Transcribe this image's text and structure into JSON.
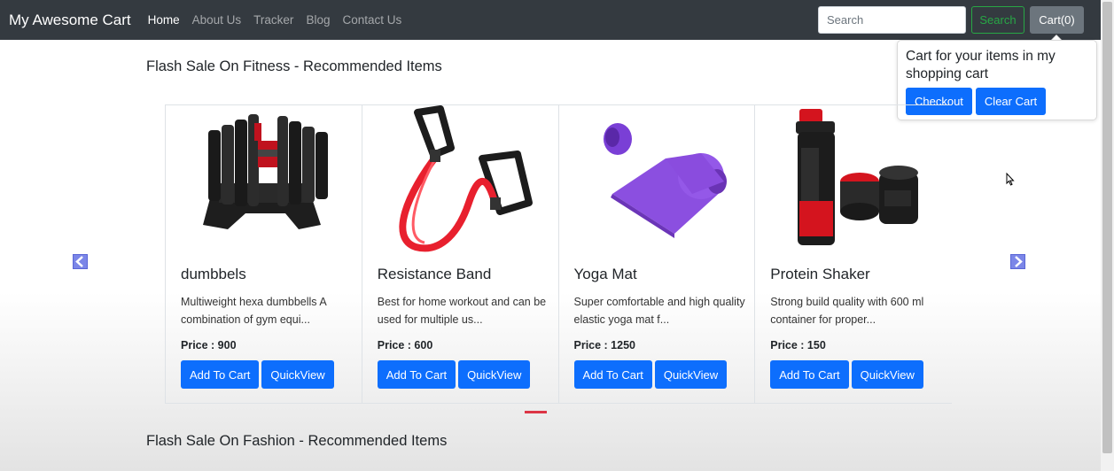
{
  "navbar": {
    "brand": "My Awesome Cart",
    "links": [
      "Home",
      "About Us",
      "Tracker",
      "Blog",
      "Contact Us"
    ],
    "search_placeholder": "Search",
    "search_button": "Search",
    "cart_button": "Cart(0)"
  },
  "cart_popover": {
    "text": "Cart for your items in my shopping cart",
    "checkout": "Checkout",
    "clear": "Clear Cart"
  },
  "sections": {
    "fitness_title": "Flash Sale On Fitness - Recommended Items",
    "fashion_title": "Flash Sale On Fashion - Recommended Items"
  },
  "products": [
    {
      "name": "dumbbels",
      "desc": "Multiweight hexa dumbbells A combination of gym equi...",
      "price": "Price : 900",
      "add": "Add To Cart",
      "quick": "QuickView",
      "icon": "dumbbell-image"
    },
    {
      "name": "Resistance Band",
      "desc": "Best for home workout and can be used for multiple us...",
      "price": "Price : 600",
      "add": "Add To Cart",
      "quick": "QuickView",
      "icon": "resistance-band-image"
    },
    {
      "name": "Yoga Mat",
      "desc": "Super comfortable and high quality elastic yoga mat f...",
      "price": "Price : 1250",
      "add": "Add To Cart",
      "quick": "QuickView",
      "icon": "yoga-mat-image"
    },
    {
      "name": "Protein Shaker",
      "desc": "Strong build quality with 600 ml container for proper...",
      "price": "Price : 150",
      "add": "Add To Cart",
      "quick": "QuickView",
      "icon": "shaker-image"
    }
  ],
  "colors": {
    "navbar": "#343a40",
    "primary": "#0d6efd",
    "success": "#28a745",
    "secondary": "#6c757d",
    "indicator": "#dc3545"
  }
}
